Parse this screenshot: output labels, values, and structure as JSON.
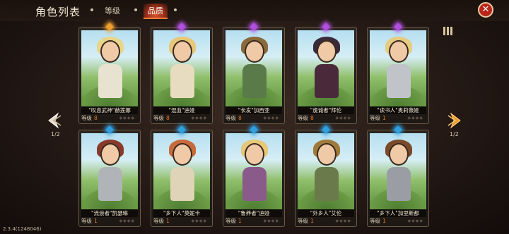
{
  "header": {
    "title": "角色列表",
    "tabs": [
      {
        "label": "等级",
        "active": false
      },
      {
        "label": "品质",
        "active": true
      }
    ],
    "close_icon": "close-icon"
  },
  "pagination": {
    "left_label": "1/2",
    "right_label": "1/2"
  },
  "level_label": "等级",
  "cards": [
    {
      "name": "\"叹息武神\"赫莲娜",
      "level": "8",
      "gem_color": "#f0a030",
      "hair": "#e9d58a",
      "outfit": "#e8e2d0"
    },
    {
      "name": "\"混血\"迪娅",
      "level": "8",
      "gem_color": "#b050e0",
      "hair": "#e6c878",
      "outfit": "#e8dcc0"
    },
    {
      "name": "\"长发\"加西亚",
      "level": "8",
      "gem_color": "#b050e0",
      "hair": "#8a6a3a",
      "outfit": "#5a7a4a"
    },
    {
      "name": "\"虔诚者\"拜伦",
      "level": "8",
      "gem_color": "#b050e0",
      "hair": "#3a2a3a",
      "outfit": "#4a2a3a"
    },
    {
      "name": "\"读书人\"奥莉薇娅",
      "level": "1",
      "gem_color": "#b050e0",
      "hair": "#e6cc80",
      "outfit": "#c0c4c8"
    },
    {
      "name": "\"流浪者\"凯瑟琳",
      "level": "1",
      "gem_color": "#30a0e0",
      "hair": "#8a3a2a",
      "outfit": "#b0b4b8"
    },
    {
      "name": "\"乡下人\"莫妮卡",
      "level": "1",
      "gem_color": "#30a0e0",
      "hair": "#c86a3a",
      "outfit": "#e0d4b8"
    },
    {
      "name": "\"鲁莽者\"迪娅",
      "level": "1",
      "gem_color": "#30a0e0",
      "hair": "#e6c878",
      "outfit": "#8a5a8a"
    },
    {
      "name": "\"外乡人\"艾伦",
      "level": "1",
      "gem_color": "#30a0e0",
      "hair": "#a07a3a",
      "outfit": "#6a7a4a"
    },
    {
      "name": "\"乡下人\"加里斯都",
      "level": "1",
      "gem_color": "#30a0e0",
      "hair": "#7a4a2a",
      "outfit": "#9a9ea4"
    }
  ],
  "version": "2.3.4(1248046)"
}
